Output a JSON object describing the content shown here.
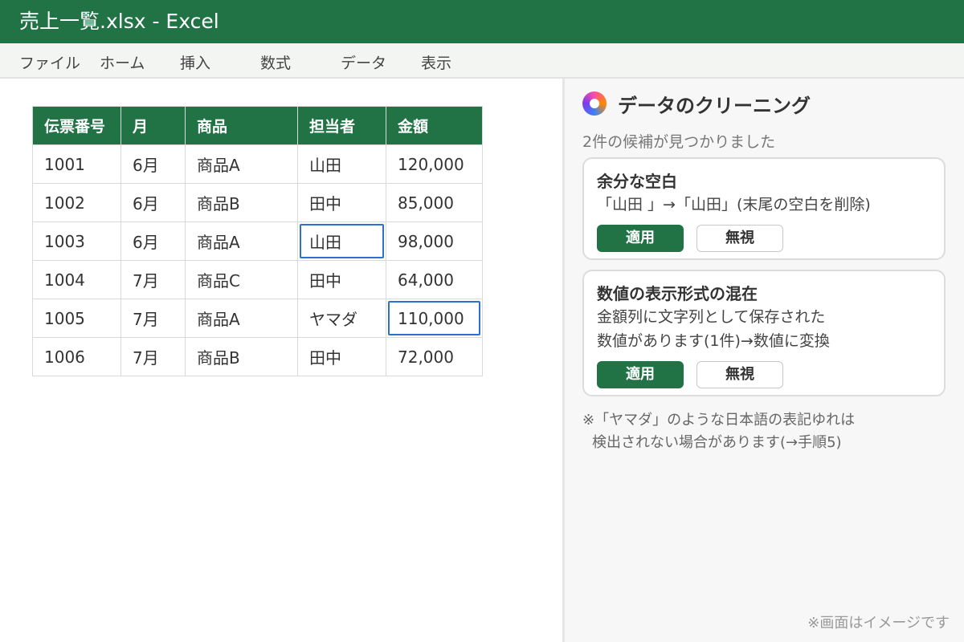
{
  "window": {
    "title": "売上一覧.xlsx - Excel"
  },
  "ribbon": {
    "tabs": [
      "ファイル",
      "ホーム",
      "挿入",
      "数式",
      "データ",
      "表示"
    ]
  },
  "sheet": {
    "headers": [
      "伝票番号",
      "月",
      "商品",
      "担当者",
      "金額"
    ],
    "rows": [
      [
        "1001",
        "6月",
        "商品A",
        "山田",
        "120,000"
      ],
      [
        "1002",
        "6月",
        "商品B",
        "田中",
        "85,000"
      ],
      [
        "1003",
        "6月",
        "商品A",
        "山田",
        "98,000"
      ],
      [
        "1004",
        "7月",
        "商品C",
        "田中",
        "64,000"
      ],
      [
        "1005",
        "7月",
        "商品A",
        "ヤマダ",
        "110,000"
      ],
      [
        "1006",
        "7月",
        "商品B",
        "田中",
        "72,000"
      ]
    ],
    "highlight_color": "#2f6fd1"
  },
  "pane": {
    "title": "データのクリーニング",
    "icon": "copilot-icon",
    "subtitle": "2件の候補が見つかりました",
    "cards": [
      {
        "title": "余分な空白",
        "desc1": "「山田 」→「山田」(末尾の空白を削除)",
        "desc2": "",
        "apply": "適用",
        "ignore": "無視"
      },
      {
        "title": "数値の表示形式の混在",
        "desc1": "金額列に文字列として保存された",
        "desc2": "数値があります(1件)→数値に変換",
        "apply": "適用",
        "ignore": "無視"
      }
    ],
    "note1": "※「ヤマダ」のような日本語の表記ゆれは",
    "note2": "検出されない場合があります(→手順5)",
    "watermark": "※画面はイメージです"
  },
  "colors": {
    "excel_green": "#217346",
    "selection": "#2f6fd1"
  }
}
